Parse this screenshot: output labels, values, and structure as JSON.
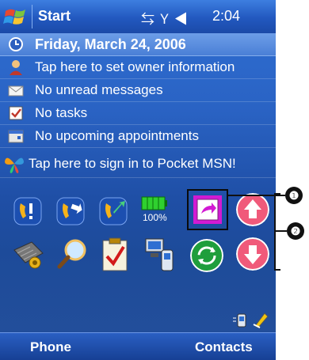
{
  "titlebar": {
    "start_label": "Start",
    "clock": "2:04",
    "status_icons": [
      "connectivity-icon",
      "signal-off-icon",
      "volume-icon"
    ]
  },
  "today": {
    "date": "Friday, March 24, 2006",
    "owner": "Tap here to set owner information",
    "messages": "No unread messages",
    "tasks": "No tasks",
    "appointments": "No upcoming appointments",
    "msn": "Tap here to sign in to Pocket MSN!"
  },
  "launcher": {
    "battery_label": "100%",
    "row1_icons": [
      "call-alert-icon",
      "call-forward-icon",
      "call-redirect-icon",
      "battery-icon",
      "highlighted-program-icon",
      "scroll-up-icon"
    ],
    "row2_icons": [
      "memory-card-icon",
      "search-icon",
      "tasks-clipboard-icon",
      "connection-manager-icon",
      "sync-icon",
      "scroll-down-icon"
    ]
  },
  "callouts": {
    "one": "❶",
    "two": "❷"
  },
  "softkeys": {
    "left": "Phone",
    "right": "Contacts"
  },
  "colors": {
    "background_top": "#2f6fd3",
    "background_bottom": "#1d4b9a",
    "highlight_magenta": "#d21ad3",
    "scroll_button": "#f05a7a"
  }
}
